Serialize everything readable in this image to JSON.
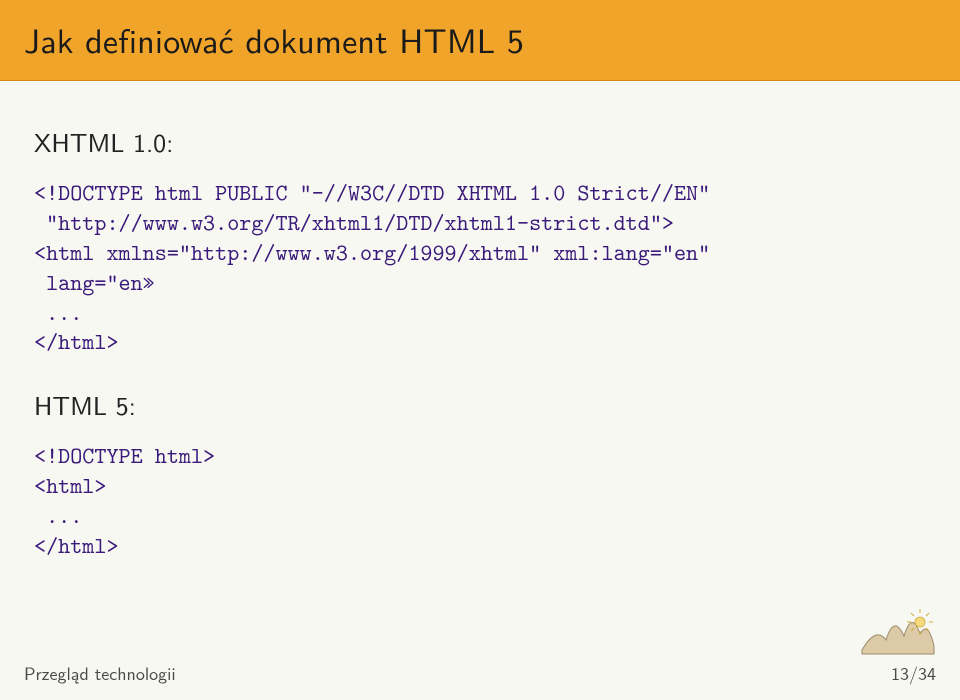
{
  "title": "Jak definiować dokument HTML 5",
  "section1": {
    "label": "XHTML 1.0:",
    "code": "<!DOCTYPE html PUBLIC \"-//W3C//DTD XHTML 1.0 Strict//EN\"\n \"http://www.w3.org/TR/xhtml1/DTD/xhtml1-strict.dtd\">\n<html xmlns=\"http://www.w3.org/1999/xhtml\" xml:lang=\"en\"\n lang=\"en»\n ...\n</html>"
  },
  "section2": {
    "label": "HTML 5:",
    "code": "<!DOCTYPE html>\n<html>\n ...\n</html>"
  },
  "footer": {
    "label": "Przegląd technologii",
    "page": "13/34"
  },
  "logo_alt": "logo-icon"
}
